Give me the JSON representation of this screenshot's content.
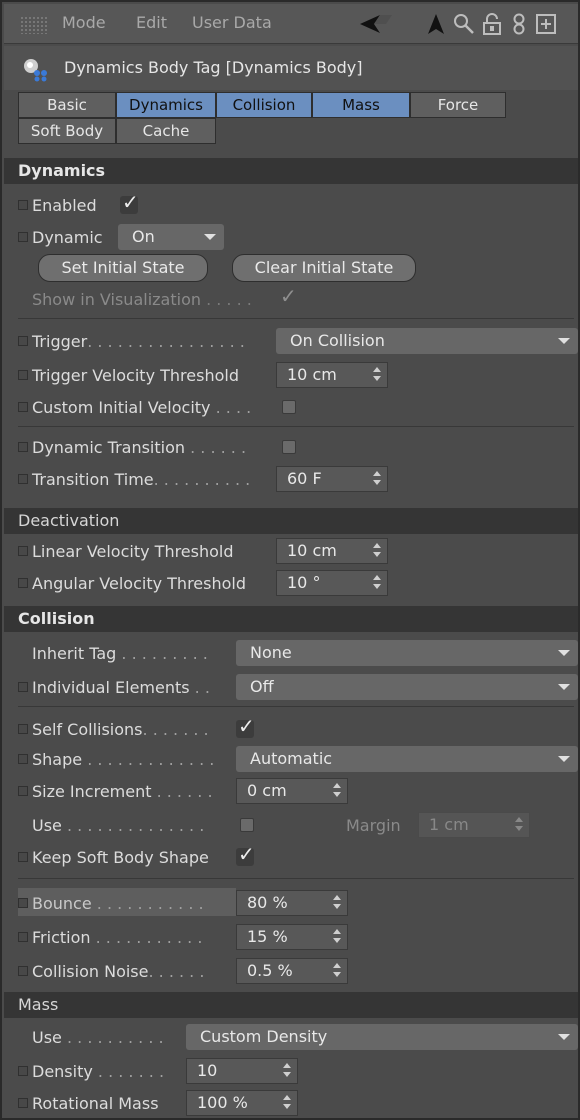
{
  "menubar": {
    "mode": "Mode",
    "edit": "Edit",
    "user_data": "User Data"
  },
  "title": "Dynamics Body Tag [Dynamics Body]",
  "tabs": [
    "Basic",
    "Dynamics",
    "Collision",
    "Mass",
    "Force",
    "Soft Body",
    "Cache"
  ],
  "active_tabs": [
    "Dynamics",
    "Collision",
    "Mass"
  ],
  "dynamics": {
    "header": "Dynamics",
    "enabled": "Enabled",
    "dynamic": "Dynamic",
    "dynamic_value": "On",
    "set_initial_state": "Set Initial State",
    "clear_initial_state": "Clear Initial State",
    "show_in_visualization": "Show in Visualization",
    "trigger": "Trigger",
    "trigger_value": "On Collision",
    "trigger_velocity_threshold": "Trigger Velocity Threshold",
    "trigger_velocity_threshold_value": "10 cm",
    "custom_initial_velocity": "Custom Initial Velocity",
    "dynamic_transition": "Dynamic Transition",
    "transition_time": "Transition Time",
    "transition_time_value": "60 F"
  },
  "deactivation": {
    "header": "Deactivation",
    "linear": "Linear Velocity Threshold",
    "linear_value": "10 cm",
    "angular": "Angular Velocity Threshold",
    "angular_value": "10 °"
  },
  "collision": {
    "header": "Collision",
    "inherit_tag": "Inherit Tag",
    "inherit_tag_value": "None",
    "individual_elements": "Individual Elements",
    "individual_elements_value": "Off",
    "self_collisions": "Self Collisions",
    "shape": "Shape",
    "shape_value": "Automatic",
    "size_increment": "Size Increment",
    "size_increment_value": "0 cm",
    "use": "Use",
    "margin": "Margin",
    "margin_value": "1 cm",
    "keep_soft_body_shape": "Keep Soft Body Shape",
    "bounce": "Bounce",
    "bounce_value": "80 %",
    "friction": "Friction",
    "friction_value": "15 %",
    "collision_noise": "Collision Noise",
    "collision_noise_value": "0.5 %"
  },
  "mass": {
    "header": "Mass",
    "use": "Use",
    "use_value": "Custom Density",
    "density": "Density",
    "density_value": "10",
    "rotational_mass": "Rotational Mass",
    "rotational_mass_value": "100 %"
  },
  "colors": {
    "active_tab": "#6b8fc0",
    "background": "#4b4b4b",
    "section_header": "#353535"
  },
  "icons": [
    "grip-icon",
    "arrow-left-icon",
    "arrow-up-icon",
    "search-icon",
    "lock-icon",
    "link-icon",
    "new-window-icon",
    "tag-icon",
    "checkmark-icon",
    "dropdown-arrow-icon",
    "spinner-icon"
  ]
}
